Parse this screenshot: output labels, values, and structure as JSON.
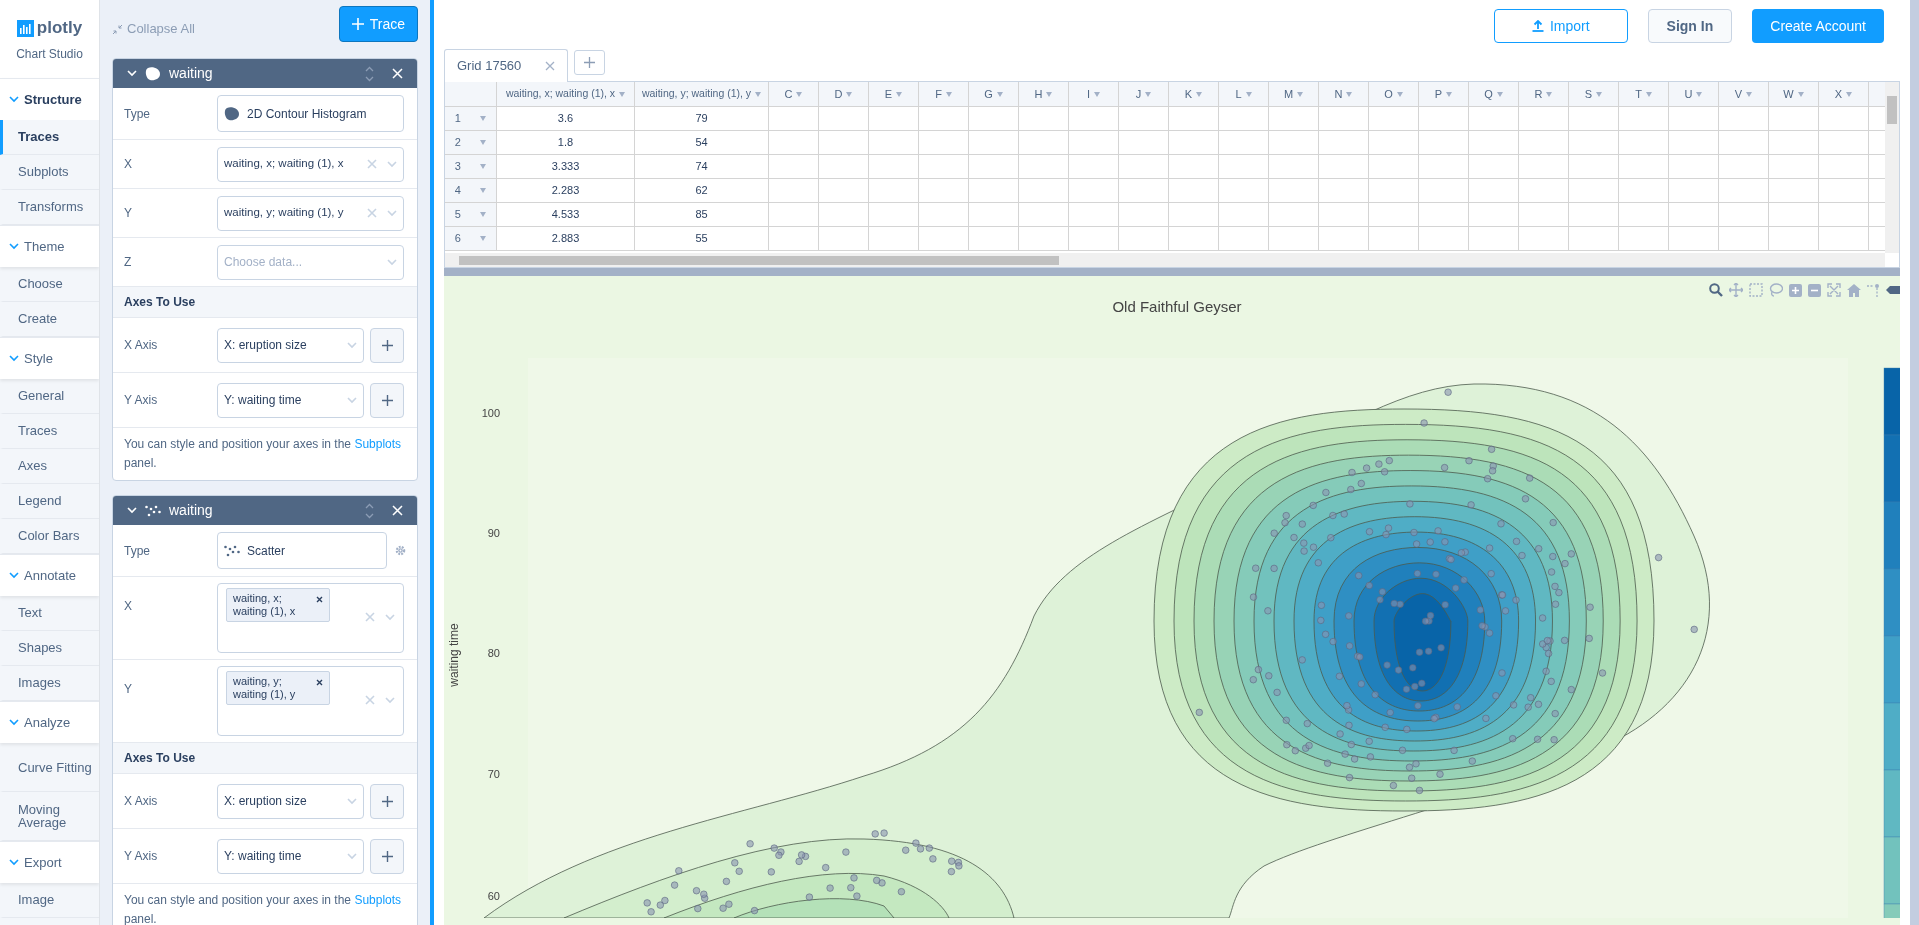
{
  "logo": {
    "name": "plotly",
    "subtitle": "Chart Studio"
  },
  "nav": [
    {
      "label": "Structure",
      "expanded": true,
      "items": [
        {
          "label": "Traces",
          "selected": true
        },
        {
          "label": "Subplots",
          "selected": false
        },
        {
          "label": "Transforms",
          "selected": false
        }
      ]
    },
    {
      "label": "Theme",
      "expanded": true,
      "items": [
        {
          "label": "Choose",
          "selected": false
        },
        {
          "label": "Create",
          "selected": false
        }
      ]
    },
    {
      "label": "Style",
      "expanded": true,
      "items": [
        {
          "label": "General",
          "selected": false
        },
        {
          "label": "Traces",
          "selected": false
        },
        {
          "label": "Axes",
          "selected": false
        },
        {
          "label": "Legend",
          "selected": false
        },
        {
          "label": "Color Bars",
          "selected": false
        }
      ]
    },
    {
      "label": "Annotate",
      "expanded": true,
      "items": [
        {
          "label": "Text",
          "selected": false
        },
        {
          "label": "Shapes",
          "selected": false
        },
        {
          "label": "Images",
          "selected": false
        }
      ]
    },
    {
      "label": "Analyze",
      "expanded": true,
      "items": [
        {
          "label": "Curve Fitting",
          "selected": false
        },
        {
          "label": "Moving Average",
          "selected": false
        }
      ]
    },
    {
      "label": "Export",
      "expanded": true,
      "items": [
        {
          "label": "Image",
          "selected": false
        }
      ]
    }
  ],
  "panel": {
    "collapse_label": "Collapse All",
    "add_label": "Trace",
    "traces": [
      {
        "name": "waiting",
        "kind": "contour",
        "expanded": true,
        "rows": [
          {
            "label": "Type",
            "kind": "type",
            "value": "2D Contour Histogram",
            "settings": false
          },
          {
            "label": "X",
            "kind": "select",
            "value": "waiting, x; waiting (1), x"
          },
          {
            "label": "Y",
            "kind": "select",
            "value": "waiting, y; waiting (1), y"
          },
          {
            "label": "Z",
            "kind": "select",
            "placeholder": "Choose data..."
          }
        ],
        "axes_heading": "Axes To Use",
        "axes": [
          {
            "label": "X Axis",
            "value": "X: eruption size"
          },
          {
            "label": "Y Axis",
            "value": "Y: waiting time"
          }
        ],
        "note": "You can style and position your axes in the ",
        "note_link": "Subplots",
        "note_end": " panel."
      },
      {
        "name": "waiting",
        "kind": "scatter",
        "expanded": true,
        "rows": [
          {
            "label": "Type",
            "kind": "type",
            "value": "Scatter",
            "settings": true
          },
          {
            "label": "X",
            "kind": "tags",
            "value": "waiting, x; waiting (1), x"
          },
          {
            "label": "Y",
            "kind": "tags",
            "value": "waiting, y; waiting (1), y"
          }
        ],
        "axes_heading": "Axes To Use",
        "axes": [
          {
            "label": "X Axis",
            "value": "X: eruption size"
          },
          {
            "label": "Y Axis",
            "value": "Y: waiting time"
          }
        ],
        "note": "You can style and position your axes in the ",
        "note_link": "Subplots",
        "note_end": " panel."
      }
    ]
  },
  "header_buttons": [
    {
      "label": "Import",
      "kind": "outline"
    },
    {
      "label": "Sign In",
      "kind": "plain"
    },
    {
      "label": "Create Account",
      "kind": "primary"
    }
  ],
  "grid": {
    "tab": "Grid 17560",
    "columns": [
      "",
      "waiting, x; waiting (1), x",
      "waiting, y; waiting (1), y",
      "C",
      "D",
      "E",
      "F",
      "G",
      "H",
      "I",
      "J",
      "K",
      "L",
      "M",
      "N",
      "O",
      "P",
      "Q",
      "R",
      "S",
      "T",
      "U",
      "V",
      "W",
      "X"
    ],
    "rows": [
      [
        "1",
        "3.6",
        "79"
      ],
      [
        "2",
        "1.8",
        "54"
      ],
      [
        "3",
        "3.333",
        "74"
      ],
      [
        "4",
        "2.283",
        "62"
      ],
      [
        "5",
        "4.533",
        "85"
      ],
      [
        "6",
        "2.883",
        "55"
      ]
    ]
  },
  "chart": {
    "title": "Old Faithful Geyser",
    "ylabel": "waiting time",
    "yticks": [
      "100",
      "90",
      "80",
      "70",
      "60"
    ]
  }
}
